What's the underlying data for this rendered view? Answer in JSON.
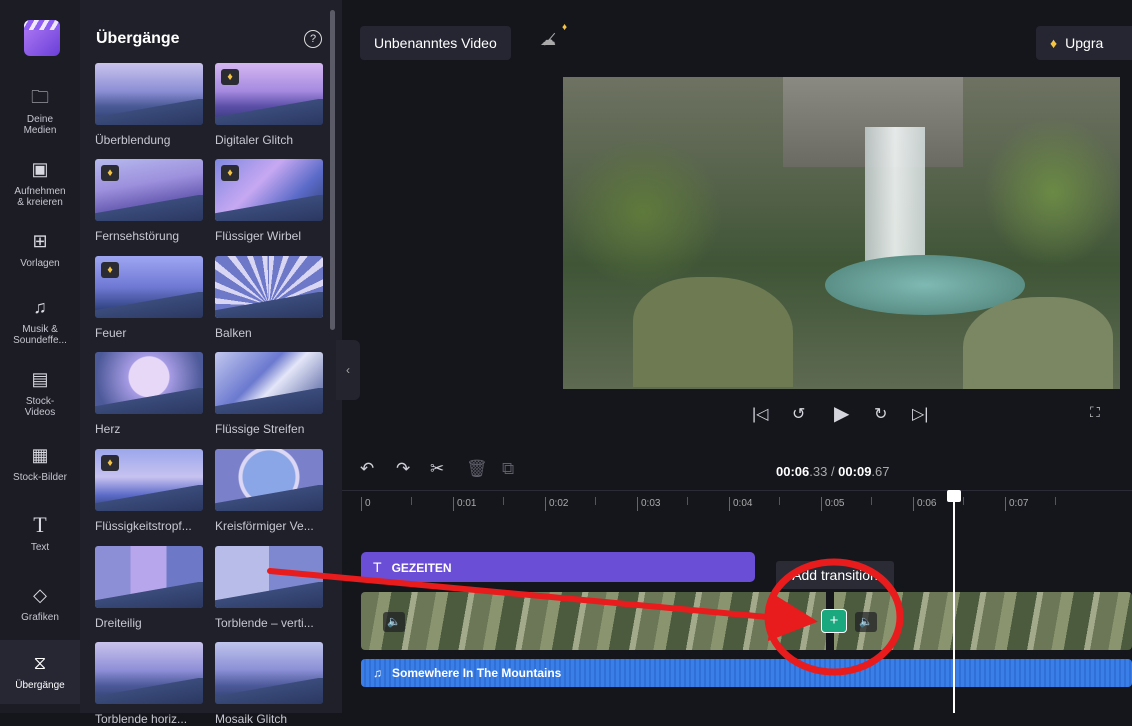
{
  "rail": {
    "items": [
      {
        "label": "Deine Medien",
        "icon": "folder-icon"
      },
      {
        "label": "Aufnehmen & kreieren",
        "icon": "camera-icon"
      },
      {
        "label": "Vorlagen",
        "icon": "templates-icon"
      },
      {
        "label": "Musik & Soundeffe...",
        "icon": "music-icon"
      },
      {
        "label": "Stock-Videos",
        "icon": "film-icon"
      },
      {
        "label": "Stock-Bilder",
        "icon": "image-icon"
      },
      {
        "label": "Text",
        "icon": "text-icon"
      },
      {
        "label": "Grafiken",
        "icon": "shapes-icon"
      },
      {
        "label": "Übergänge",
        "icon": "transitions-icon"
      }
    ]
  },
  "panel": {
    "title": "Übergänge",
    "help": "?",
    "tiles": [
      {
        "label": "Überblendung",
        "premium": false
      },
      {
        "label": "Digitaler Glitch",
        "premium": true
      },
      {
        "label": "Fernsehstörung",
        "premium": true
      },
      {
        "label": "Flüssiger Wirbel",
        "premium": true
      },
      {
        "label": "Feuer",
        "premium": true
      },
      {
        "label": "Balken",
        "premium": false
      },
      {
        "label": "Herz",
        "premium": false
      },
      {
        "label": "Flüssige Streifen",
        "premium": false
      },
      {
        "label": "Flüssigkeitstropf...",
        "premium": true
      },
      {
        "label": "Kreisförmiger Ve...",
        "premium": false
      },
      {
        "label": "Dreiteilig",
        "premium": false
      },
      {
        "label": "Torblende – verti...",
        "premium": false
      },
      {
        "label": "Torblende horiz...",
        "premium": false
      },
      {
        "label": "Mosaik Glitch",
        "premium": false
      }
    ]
  },
  "header": {
    "project_title": "Unbenanntes Video",
    "upgrade_label": "Upgra"
  },
  "timeline": {
    "current_time_main": "00:06",
    "current_time_frac": ".33",
    "separator": " / ",
    "total_time_main": "00:09",
    "total_time_frac": ".67",
    "ticks": [
      "0",
      "0:01",
      "0:02",
      "0:03",
      "0:04",
      "0:05",
      "0:06",
      "0:07"
    ],
    "text_clip": "GEZEITEN",
    "tooltip": "Add transition",
    "audio_clip": "Somewhere In The Mountains"
  },
  "colors": {
    "accent": "#6a4fd6",
    "audio": "#3a7ee8",
    "add_transition": "#1aa87f",
    "annotation": "#e81c1c",
    "premium": "#f5c542"
  }
}
